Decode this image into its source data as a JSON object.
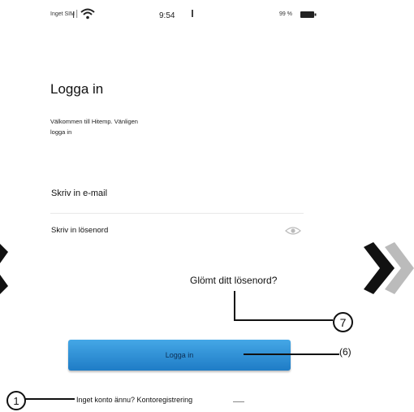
{
  "status_bar": {
    "carrier": "Inget SIM",
    "time": "9:54",
    "battery": "99 %"
  },
  "login": {
    "title": "Logga in",
    "welcome_line1": "Välkommen till Hitemp. Vänligen",
    "welcome_line2": "logga in",
    "email_placeholder": "Skriv in e-mail",
    "password_placeholder": "Skriv in lösenord",
    "forgot": "Glömt ditt lösenord?",
    "button": "Logga in",
    "register": "Inget konto ännu? Kontoregistrering"
  },
  "callouts": {
    "forgot": "7",
    "button": "(6)",
    "register": "1"
  },
  "icons": [
    "wifi-icon",
    "battery-icon",
    "eye-icon",
    "chevron-left-icon",
    "chevron-right-icon"
  ],
  "colors": {
    "button": "#2a8fd6"
  }
}
